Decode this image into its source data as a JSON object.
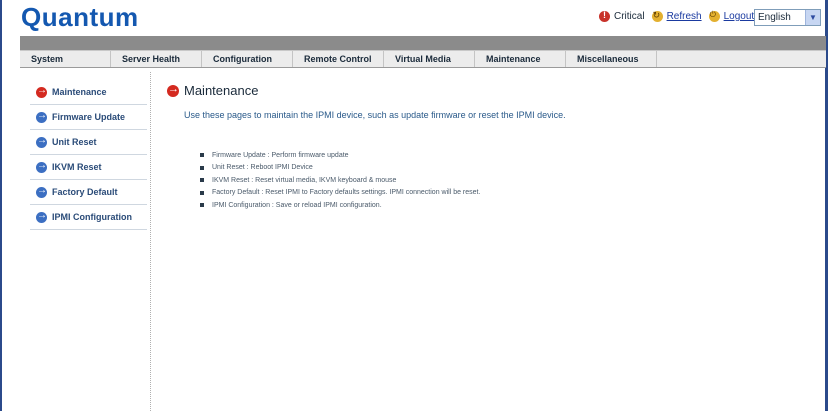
{
  "header": {
    "logo": "Quantum",
    "critical_label": "Critical",
    "refresh_label": "Refresh",
    "logout_label": "Logout",
    "language_selected": "English"
  },
  "nav": {
    "items": [
      {
        "label": "System"
      },
      {
        "label": "Server Health"
      },
      {
        "label": "Configuration"
      },
      {
        "label": "Remote Control"
      },
      {
        "label": "Virtual Media"
      },
      {
        "label": "Maintenance"
      },
      {
        "label": "Miscellaneous"
      }
    ]
  },
  "sidebar": {
    "items": [
      {
        "label": "Maintenance",
        "active": true
      },
      {
        "label": "Firmware Update"
      },
      {
        "label": "Unit Reset"
      },
      {
        "label": "IKVM Reset"
      },
      {
        "label": "Factory Default"
      },
      {
        "label": "IPMI Configuration"
      }
    ]
  },
  "main": {
    "title": "Maintenance",
    "intro": "Use these pages to maintain the IPMI device, such as update firmware or reset the IPMI device.",
    "bullets": [
      "Firmware Update : Perform firmware update",
      "Unit Reset : Reboot IPMI Device",
      "IKVM Reset : Reset virtual media, IKVM keyboard & mouse",
      "Factory Default : Reset IPMI to Factory defaults settings. IPMI connection will be reset.",
      "IPMI Configuration : Save or reload IPMI configuration."
    ]
  },
  "colors": {
    "logo": "#1458b0",
    "nav_bar": "#8b8b8b",
    "active_arrow": "#d42a20",
    "inactive_arrow": "#3c6fc2",
    "window_edge": "#2b4a8b"
  }
}
